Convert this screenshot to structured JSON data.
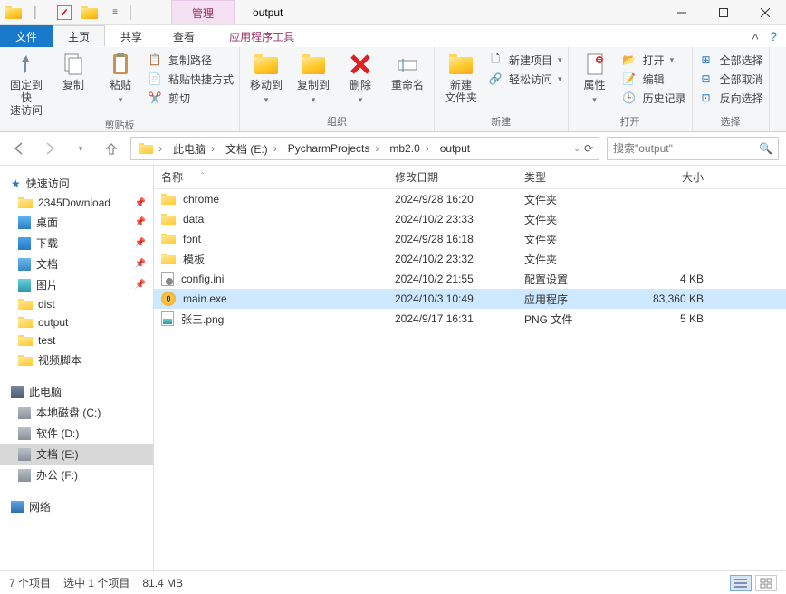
{
  "window": {
    "title": "output",
    "context_tab": "管理"
  },
  "tabs": {
    "file": "文件",
    "home": "主页",
    "share": "共享",
    "view": "查看",
    "app_tools": "应用程序工具"
  },
  "ribbon": {
    "clipboard": {
      "label": "剪贴板",
      "pin": "固定到快\n速访问",
      "copy": "复制",
      "paste": "粘贴",
      "copy_path": "复制路径",
      "paste_shortcut": "粘贴快捷方式",
      "cut": "剪切"
    },
    "organize": {
      "label": "组织",
      "move_to": "移动到",
      "copy_to": "复制到",
      "delete": "删除",
      "rename": "重命名"
    },
    "new": {
      "label": "新建",
      "new_folder": "新建\n文件夹",
      "new_item": "新建项目",
      "easy_access": "轻松访问"
    },
    "open": {
      "label": "打开",
      "properties": "属性",
      "open": "打开",
      "edit": "编辑",
      "history": "历史记录"
    },
    "select": {
      "label": "选择",
      "select_all": "全部选择",
      "select_none": "全部取消",
      "invert": "反向选择"
    }
  },
  "breadcrumb": [
    "此电脑",
    "文档 (E:)",
    "PycharmProjects",
    "mb2.0",
    "output"
  ],
  "search": {
    "placeholder": "搜索\"output\""
  },
  "nav": {
    "quick_access": "快速访问",
    "qa_items": [
      {
        "label": "2345Download",
        "icon": "folder",
        "pinned": true
      },
      {
        "label": "桌面",
        "icon": "desktop",
        "pinned": true
      },
      {
        "label": "下载",
        "icon": "download",
        "pinned": true
      },
      {
        "label": "文档",
        "icon": "document",
        "pinned": true
      },
      {
        "label": "图片",
        "icon": "picture",
        "pinned": true
      },
      {
        "label": "dist",
        "icon": "folder",
        "pinned": false
      },
      {
        "label": "output",
        "icon": "folder",
        "pinned": false
      },
      {
        "label": "test",
        "icon": "folder",
        "pinned": false
      },
      {
        "label": "视频脚本",
        "icon": "folder",
        "pinned": false
      }
    ],
    "this_pc": "此电脑",
    "drives": [
      {
        "label": "本地磁盘 (C:)"
      },
      {
        "label": "软件 (D:)"
      },
      {
        "label": "文档 (E:)",
        "selected": true
      },
      {
        "label": "办公 (F:)"
      }
    ],
    "network": "网络"
  },
  "columns": {
    "name": "名称",
    "date": "修改日期",
    "type": "类型",
    "size": "大小"
  },
  "files": [
    {
      "name": "chrome",
      "date": "2024/9/28 16:20",
      "type": "文件夹",
      "size": "",
      "icon": "folder"
    },
    {
      "name": "data",
      "date": "2024/10/2 23:33",
      "type": "文件夹",
      "size": "",
      "icon": "folder"
    },
    {
      "name": "font",
      "date": "2024/9/28 16:18",
      "type": "文件夹",
      "size": "",
      "icon": "folder"
    },
    {
      "name": "模板",
      "date": "2024/10/2 23:32",
      "type": "文件夹",
      "size": "",
      "icon": "folder"
    },
    {
      "name": "config.ini",
      "date": "2024/10/2 21:55",
      "type": "配置设置",
      "size": "4 KB",
      "icon": "ini"
    },
    {
      "name": "main.exe",
      "date": "2024/10/3 10:49",
      "type": "应用程序",
      "size": "83,360 KB",
      "icon": "exe",
      "selected": true
    },
    {
      "name": "张三.png",
      "date": "2024/9/17 16:31",
      "type": "PNG 文件",
      "size": "5 KB",
      "icon": "png"
    }
  ],
  "status": {
    "items": "7 个项目",
    "selected": "选中 1 个项目",
    "size": "81.4 MB"
  }
}
